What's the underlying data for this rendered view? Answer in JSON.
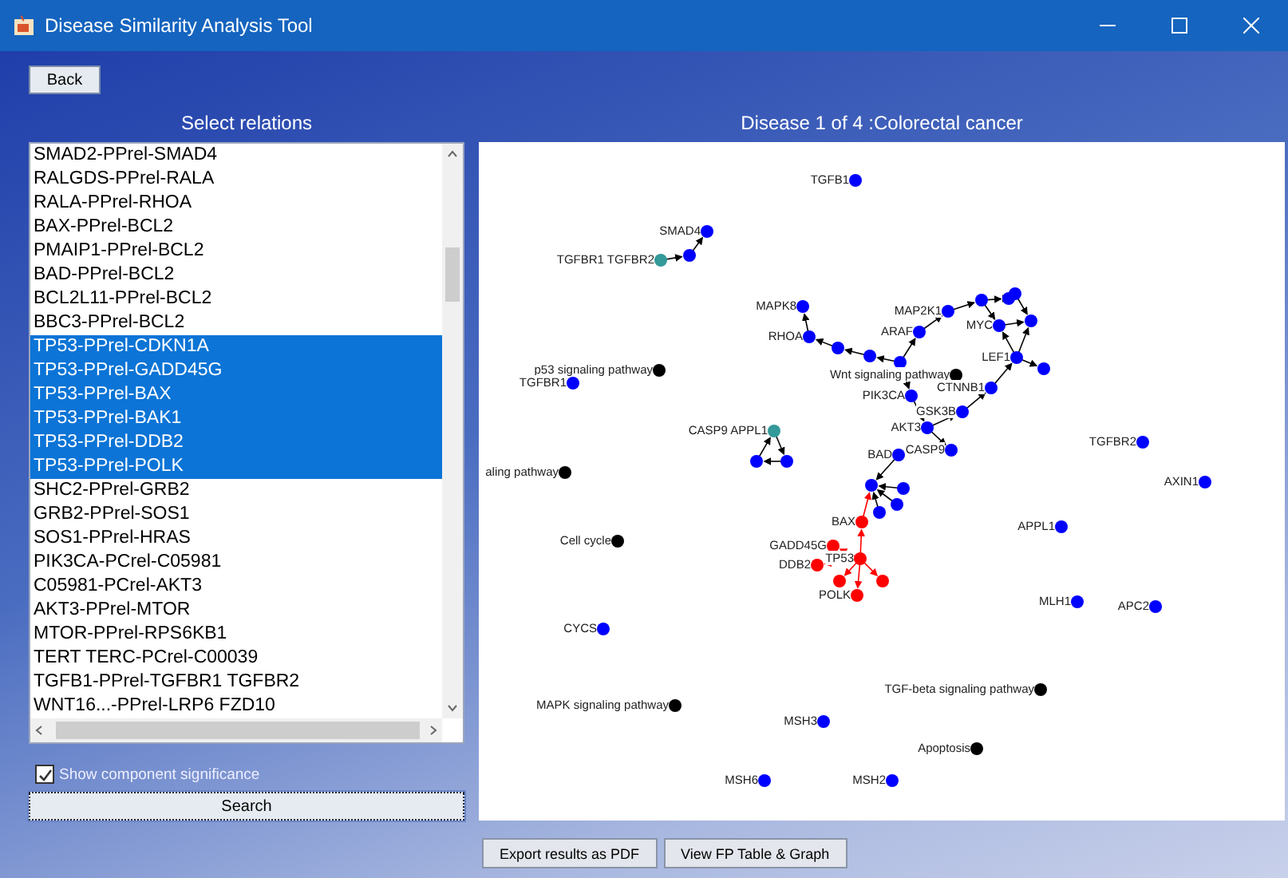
{
  "window": {
    "title": "Disease Similarity Analysis Tool"
  },
  "back_button": "Back",
  "relations": {
    "title": "Select relations",
    "items": [
      {
        "label": "SMAD2-PPrel-SMAD4",
        "selected": false
      },
      {
        "label": "RALGDS-PPrel-RALA",
        "selected": false
      },
      {
        "label": "RALA-PPrel-RHOA",
        "selected": false
      },
      {
        "label": "BAX-PPrel-BCL2",
        "selected": false
      },
      {
        "label": "PMAIP1-PPrel-BCL2",
        "selected": false
      },
      {
        "label": "BAD-PPrel-BCL2",
        "selected": false
      },
      {
        "label": "BCL2L11-PPrel-BCL2",
        "selected": false
      },
      {
        "label": "BBC3-PPrel-BCL2",
        "selected": false
      },
      {
        "label": "TP53-PPrel-CDKN1A",
        "selected": true
      },
      {
        "label": "TP53-PPrel-GADD45G",
        "selected": true
      },
      {
        "label": "TP53-PPrel-BAX",
        "selected": true
      },
      {
        "label": "TP53-PPrel-BAK1",
        "selected": true
      },
      {
        "label": "TP53-PPrel-DDB2",
        "selected": true
      },
      {
        "label": "TP53-PPrel-POLK",
        "selected": true
      },
      {
        "label": "SHC2-PPrel-GRB2",
        "selected": false
      },
      {
        "label": "GRB2-PPrel-SOS1",
        "selected": false
      },
      {
        "label": "SOS1-PPrel-HRAS",
        "selected": false
      },
      {
        "label": "PIK3CA-PCrel-C05981",
        "selected": false
      },
      {
        "label": "C05981-PCrel-AKT3",
        "selected": false
      },
      {
        "label": "AKT3-PPrel-MTOR",
        "selected": false
      },
      {
        "label": "MTOR-PPrel-RPS6KB1",
        "selected": false
      },
      {
        "label": "TERT TERC-PCrel-C00039",
        "selected": false
      },
      {
        "label": "TGFB1-PPrel-TGFBR1 TGFBR2",
        "selected": false
      },
      {
        "label": "WNT16...-PPrel-LRP6 FZD10",
        "selected": false
      }
    ]
  },
  "show_significance": {
    "label": "Show component significance",
    "checked": true
  },
  "search_button": "Search",
  "graph": {
    "title": "Disease 1 of 4 :Colorectal cancer",
    "nodes": [
      {
        "label": "TGFB1",
        "color": "#0000ff"
      },
      {
        "label": "SMAD4",
        "color": "#0000ff"
      },
      {
        "color": "#0000ff"
      },
      {
        "label": "TGFBR1 TGFBR2",
        "color": "#339999"
      },
      {
        "label": "MAPK8",
        "color": "#0000ff"
      },
      {
        "label": "RHOA",
        "color": "#0000ff"
      },
      {
        "color": "#0000ff"
      },
      {
        "color": "#0000ff"
      },
      {
        "label": "MAP2K1",
        "color": "#0000ff"
      },
      {
        "label": "ARAF",
        "color": "#0000ff"
      },
      {
        "color": "#0000ff"
      },
      {
        "label": "Wnt signaling pathway",
        "color": "#000000"
      },
      {
        "color": "#0000ff"
      },
      {
        "color": "#0000ff"
      },
      {
        "color": "#0000ff"
      },
      {
        "label": "MYC",
        "color": "#0000ff"
      },
      {
        "color": "#0000ff"
      },
      {
        "label": "LEF1",
        "color": "#0000ff"
      },
      {
        "color": "#0000ff"
      },
      {
        "label": "CTNNB1",
        "color": "#0000ff"
      },
      {
        "label": "GSK3B",
        "color": "#0000ff"
      },
      {
        "label": "PIK3CA",
        "color": "#0000ff"
      },
      {
        "label": "AKT3",
        "color": "#0000ff"
      },
      {
        "label": "CASP9",
        "color": "#0000ff"
      },
      {
        "label": "BAD",
        "color": "#0000ff"
      },
      {
        "color": "#0000ff"
      },
      {
        "color": "#0000ff"
      },
      {
        "color": "#0000ff"
      },
      {
        "color": "#0000ff"
      },
      {
        "label": "BAX",
        "color": "#ff0000"
      },
      {
        "label": "GADD45G",
        "color": "#ff0000"
      },
      {
        "label": "TP53",
        "color": "#ff0000"
      },
      {
        "label": "DDB2",
        "color": "#ff0000"
      },
      {
        "color": "#ff0000"
      },
      {
        "color": "#ff0000"
      },
      {
        "label": "POLK",
        "color": "#ff0000"
      },
      {
        "label": "CASP9 APPL1",
        "color": "#339999"
      },
      {
        "color": "#0000ff"
      },
      {
        "color": "#0000ff"
      },
      {
        "label": "p53 signaling pathway",
        "color": "#000000"
      },
      {
        "label": "TGFBR1",
        "color": "#0000ff"
      },
      {
        "label": "aling pathway",
        "color": "#000000"
      },
      {
        "label": "Cell cycle",
        "color": "#000000"
      },
      {
        "label": "CYCS",
        "color": "#0000ff"
      },
      {
        "label": "MAPK signaling pathway",
        "color": "#000000"
      },
      {
        "label": "MSH3",
        "color": "#0000ff"
      },
      {
        "label": "TGF-beta signaling pathway",
        "color": "#000000"
      },
      {
        "label": "Apoptosis",
        "color": "#000000"
      },
      {
        "label": "MSH6",
        "color": "#0000ff"
      },
      {
        "label": "MSH2",
        "color": "#0000ff"
      },
      {
        "label": "TGFBR2",
        "color": "#0000ff"
      },
      {
        "label": "AXIN1",
        "color": "#0000ff"
      },
      {
        "label": "APPL1",
        "color": "#0000ff"
      },
      {
        "label": "MLH1",
        "color": "#0000ff"
      },
      {
        "label": "APC2",
        "color": "#0000ff"
      }
    ]
  },
  "footer_buttons": [
    "Export results as PDF",
    "View FP Table & Graph"
  ]
}
